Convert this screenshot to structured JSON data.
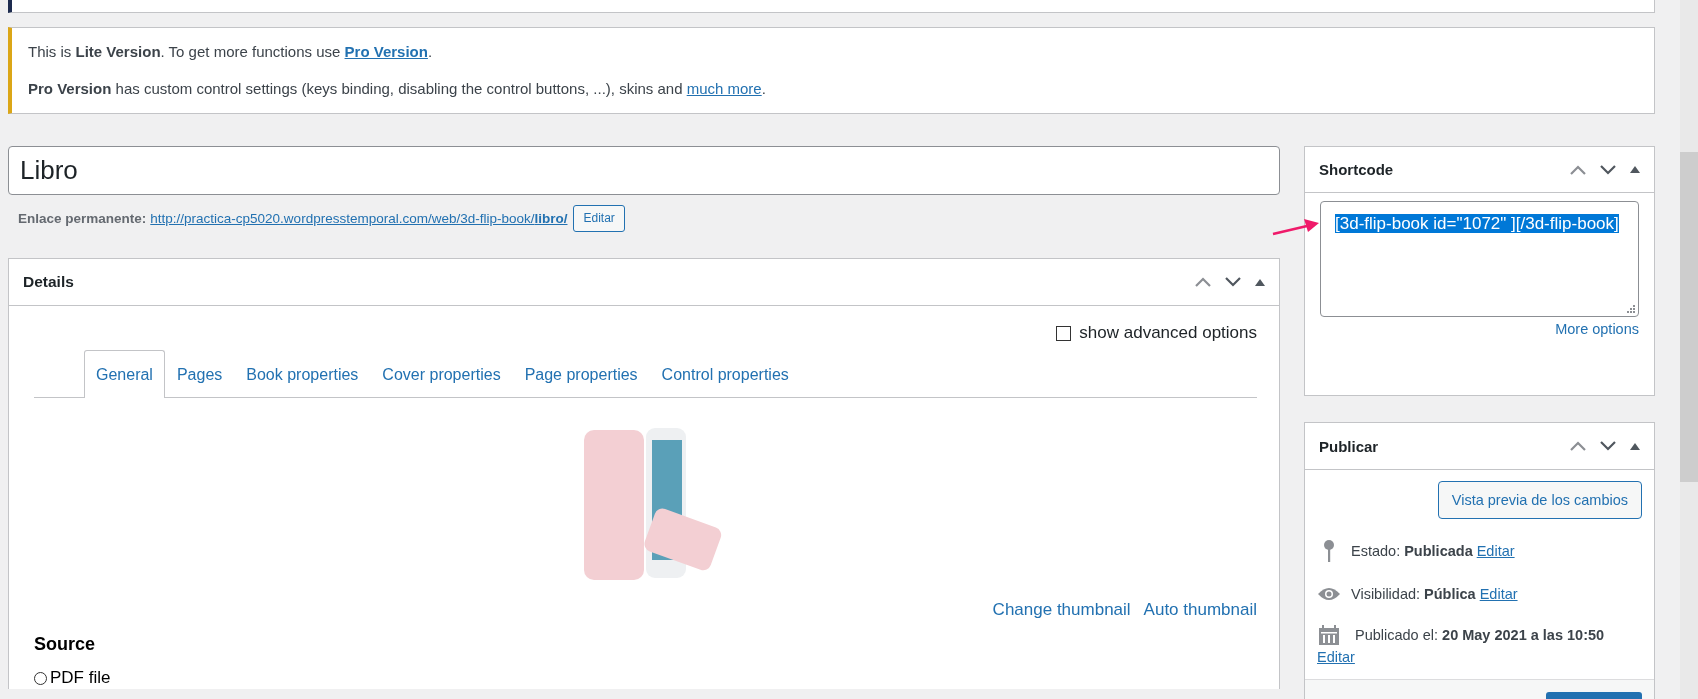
{
  "notice": {
    "lines": [
      [
        {
          "kind": "text",
          "text": "This is **Lite Version**. To get more functions use "
        },
        {
          "kind": "link",
          "text": "Pro Version",
          "bold": true
        },
        {
          "kind": "text",
          "text": "."
        }
      ],
      [
        {
          "kind": "text",
          "text": "**Pro Version** has custom control settings (keys binding, disabling the control buttons, ...), skins and "
        },
        {
          "kind": "link",
          "text": "much more",
          "bold": false
        },
        {
          "kind": "text",
          "text": "."
        }
      ]
    ]
  },
  "title": {
    "value": "Libro"
  },
  "permalink": {
    "label": "Enlace permanente:",
    "url": "http://practica-cp5020.wordpresstemporal.com/web/3d-flip-book/**libro/**",
    "button": "Editar"
  },
  "details": {
    "title": "Details",
    "advanced": {
      "label": "show advanced options",
      "checked": false
    },
    "tabs": [
      {
        "label": "General",
        "selected": true
      },
      {
        "label": "Pages",
        "selected": false
      },
      {
        "label": "Book properties",
        "selected": false
      },
      {
        "label": "Cover properties",
        "selected": false
      },
      {
        "label": "Page properties",
        "selected": false
      },
      {
        "label": "Control properties",
        "selected": false
      }
    ],
    "thumbnail_links": [
      "Change thumbnail",
      "Auto thumbnail"
    ],
    "source": {
      "title": "Source",
      "options": [
        {
          "label": "PDF file",
          "selected": false
        }
      ]
    }
  },
  "shortcode": {
    "title": "Shortcode",
    "value": "[3d-flip-book id=\"1072\" ][/3d-flip-book]",
    "selected": true,
    "more": "More options"
  },
  "publish": {
    "title": "Publicar",
    "preview_button": "Vista previa de los cambios",
    "rows": [
      {
        "kind": "status",
        "text": "Estado: **Publicada**",
        "link": "Editar"
      },
      {
        "kind": "visibility",
        "text": "Visibilidad: **Pública**",
        "link": "Editar"
      },
      {
        "kind": "date",
        "text": "Publicado el: **20 May 2021 a las 10:50**",
        "link": "Editar"
      }
    ]
  }
}
